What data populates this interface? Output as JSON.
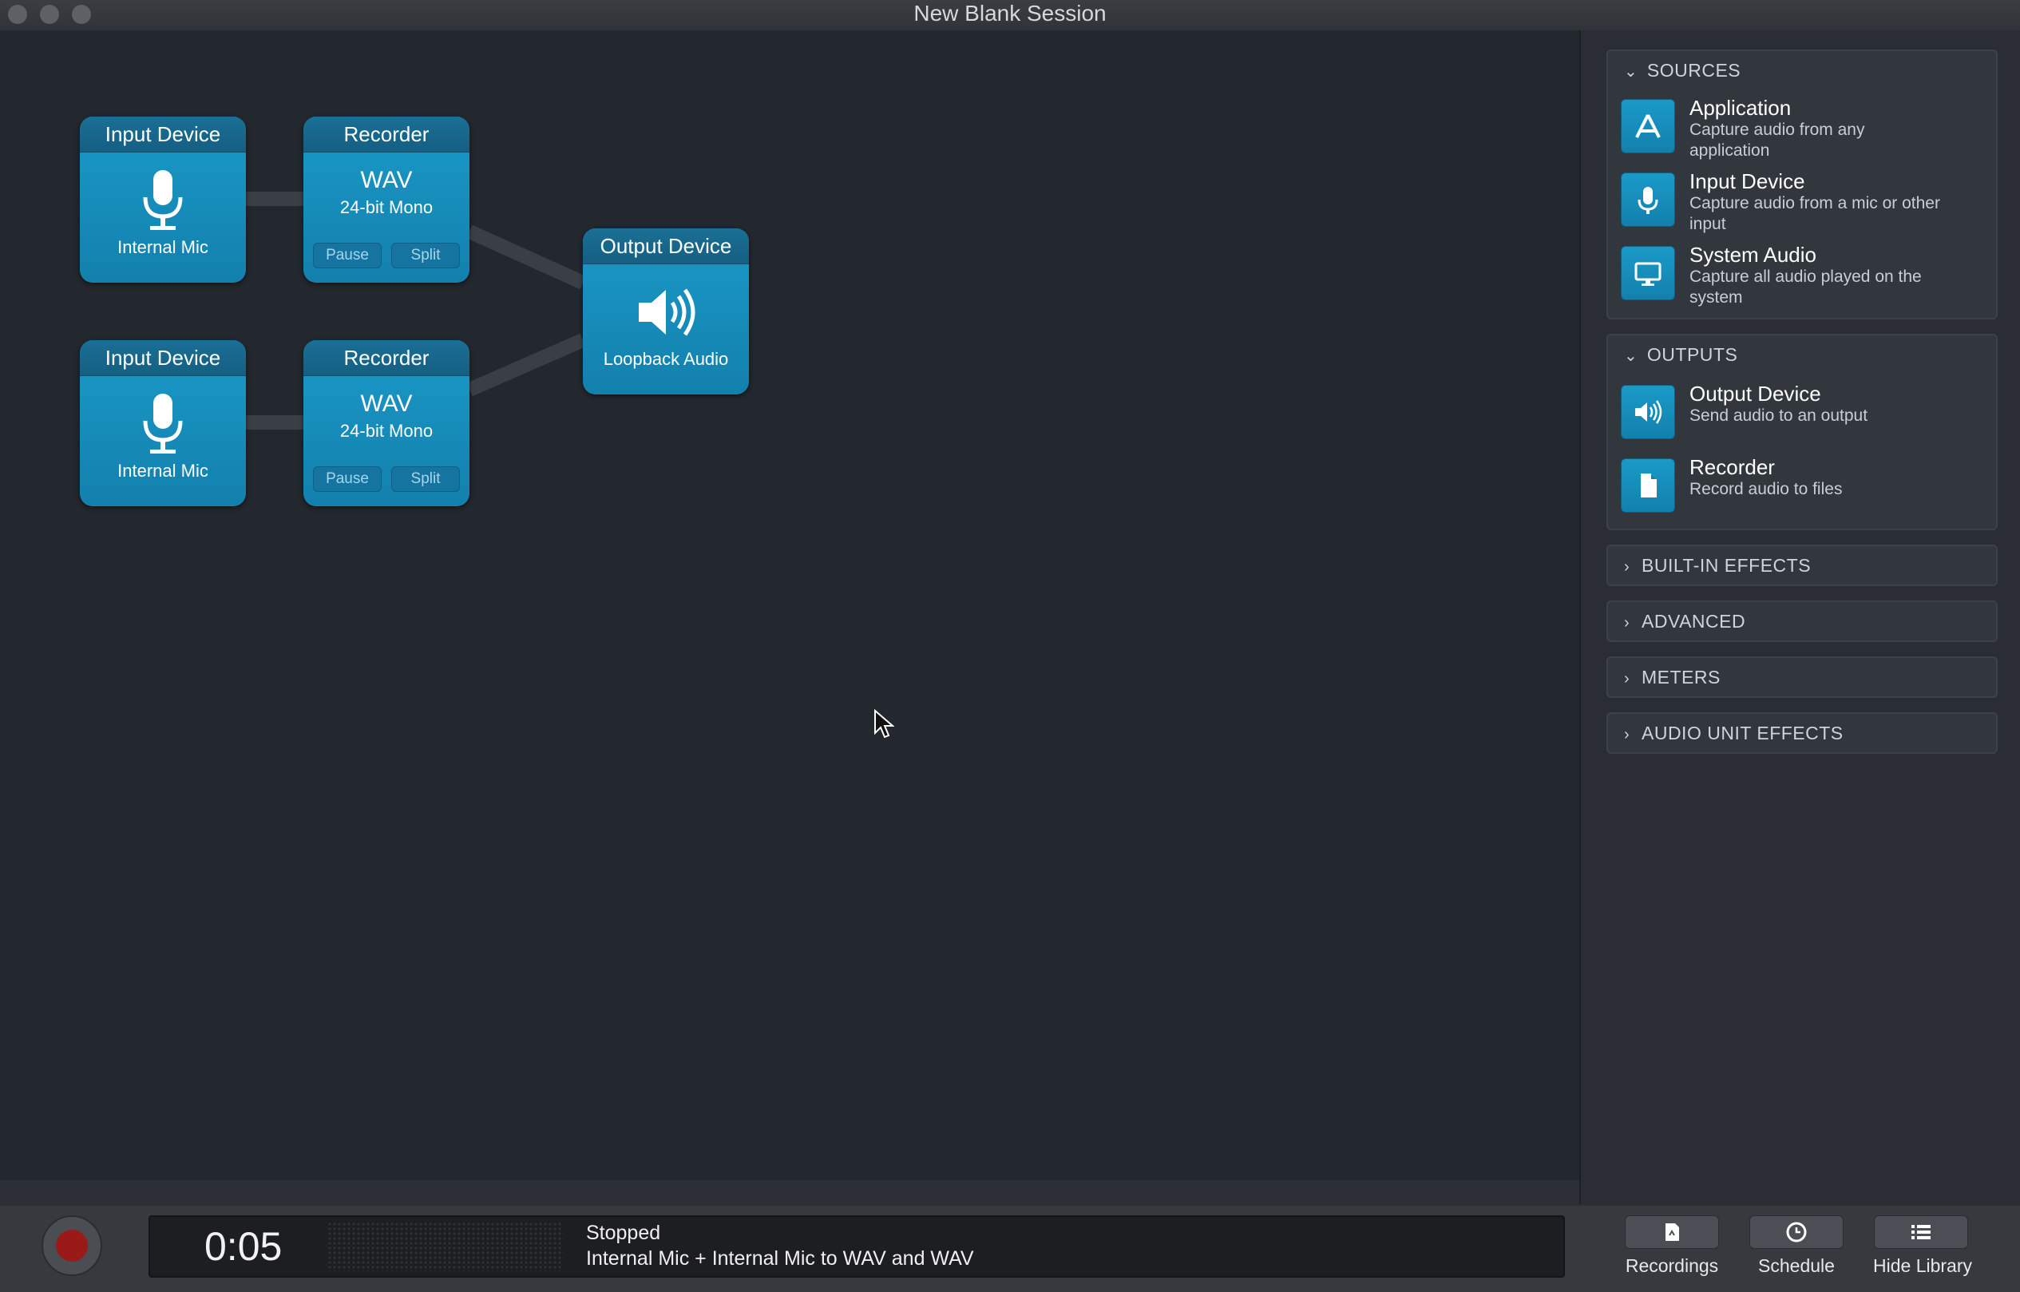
{
  "window": {
    "title": "New Blank Session"
  },
  "graph": {
    "input1": {
      "header": "Input Device",
      "label": "Internal Mic"
    },
    "recorder1": {
      "header": "Recorder",
      "format": "WAV",
      "bits": "24-bit Mono",
      "pause": "Pause",
      "split": "Split"
    },
    "input2": {
      "header": "Input Device",
      "label": "Internal Mic"
    },
    "recorder2": {
      "header": "Recorder",
      "format": "WAV",
      "bits": "24-bit Mono",
      "pause": "Pause",
      "split": "Split"
    },
    "output": {
      "header": "Output Device",
      "label": "Loopback Audio"
    }
  },
  "library": {
    "sources": {
      "title": "SOURCES",
      "items": [
        {
          "title": "Application",
          "desc": "Capture audio from any application",
          "icon": "application-icon"
        },
        {
          "title": "Input Device",
          "desc": "Capture audio from a mic or other input",
          "icon": "microphone-icon"
        },
        {
          "title": "System Audio",
          "desc": "Capture all audio played on the system",
          "icon": "monitor-icon"
        }
      ]
    },
    "outputs": {
      "title": "OUTPUTS",
      "items": [
        {
          "title": "Output Device",
          "desc": "Send audio to an output",
          "icon": "speaker-icon"
        },
        {
          "title": "Recorder",
          "desc": "Record audio to files",
          "icon": "file-icon"
        }
      ]
    },
    "collapsed": [
      "BUILT-IN EFFECTS",
      "ADVANCED",
      "METERS",
      "AUDIO UNIT EFFECTS"
    ]
  },
  "footer": {
    "time": "0:05",
    "status": "Stopped",
    "detail": "Internal Mic + Internal Mic to WAV and WAV",
    "recordings": "Recordings",
    "schedule": "Schedule",
    "hide_library": "Hide Library"
  },
  "colors": {
    "node": "#1a9ac8",
    "node_header": "#1a6f95",
    "background": "#23272e"
  }
}
